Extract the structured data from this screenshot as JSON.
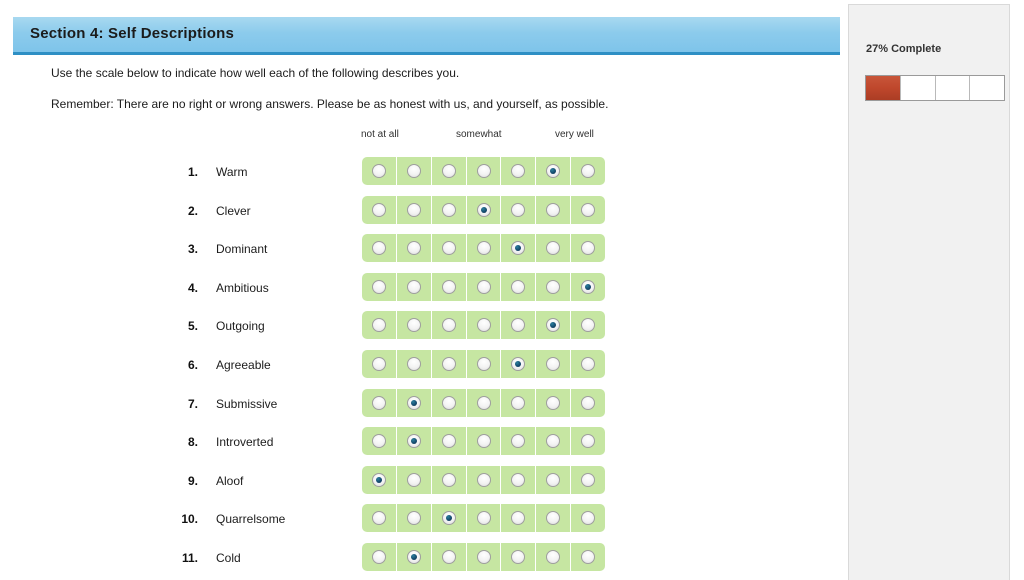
{
  "section": {
    "title": "Section 4:  Self Descriptions"
  },
  "instructions": [
    "Use the scale below to indicate how well each of the following describes you.",
    "Remember: There are no right or wrong answers. Please be as honest with us, and yourself, as possible."
  ],
  "scale": {
    "points": 7,
    "anchor_low": "not at all",
    "anchor_mid": "somewhat",
    "anchor_high": "very well"
  },
  "items": [
    {
      "number": "1.",
      "label": "Warm",
      "selected": 6
    },
    {
      "number": "2.",
      "label": "Clever",
      "selected": 4
    },
    {
      "number": "3.",
      "label": "Dominant",
      "selected": 5
    },
    {
      "number": "4.",
      "label": "Ambitious",
      "selected": 7
    },
    {
      "number": "5.",
      "label": "Outgoing",
      "selected": 6
    },
    {
      "number": "6.",
      "label": "Agreeable",
      "selected": 5
    },
    {
      "number": "7.",
      "label": "Submissive",
      "selected": 2
    },
    {
      "number": "8.",
      "label": "Introverted",
      "selected": 2
    },
    {
      "number": "9.",
      "label": "Aloof",
      "selected": 1
    },
    {
      "number": "10.",
      "label": "Quarrelsome",
      "selected": 3
    },
    {
      "number": "11.",
      "label": "Cold",
      "selected": 2
    }
  ],
  "progress": {
    "label": "27% Complete",
    "percent": 27,
    "segments": 4,
    "filled_segments": 1
  },
  "colors": {
    "header_blue": "#8ccbec",
    "header_border_blue": "#2e8fc4",
    "scale_green": "#c6e6a2",
    "radio_selected": "#14486b",
    "progress_fill": "#bf472c",
    "sidebar_background": "#f1f1f1"
  }
}
